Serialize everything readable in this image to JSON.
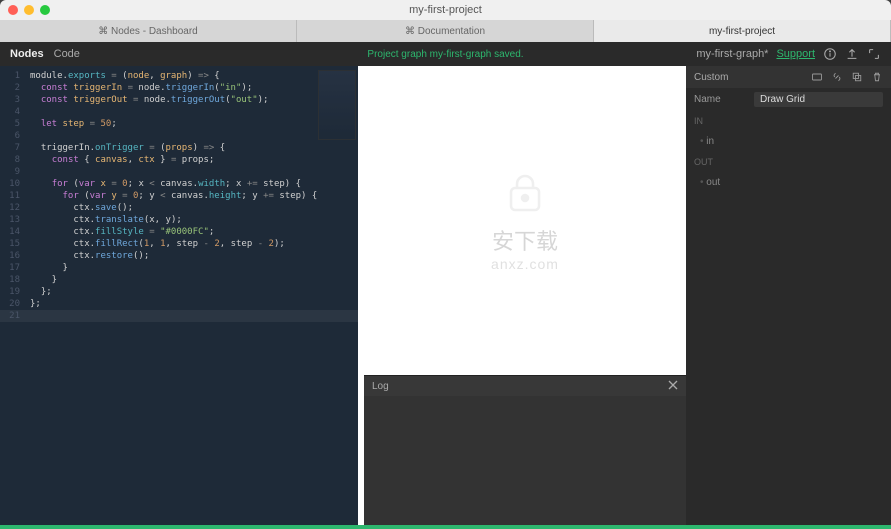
{
  "window": {
    "title": "my-first-project"
  },
  "tabs": [
    {
      "label": "⌘ Nodes - Dashboard",
      "active": false
    },
    {
      "label": "⌘ Documentation",
      "active": false
    },
    {
      "label": "my-first-project",
      "active": true
    }
  ],
  "header": {
    "brand": "Nodes",
    "mode": "Code",
    "status_message": "Project graph my-first-graph saved.",
    "graph_name": "my-first-graph*",
    "support": "Support"
  },
  "code": {
    "lines": [
      "module.exports = (node, graph) => {",
      "  const triggerIn = node.triggerIn(\"in\");",
      "  const triggerOut = node.triggerOut(\"out\");",
      "",
      "  let step = 50;",
      "",
      "  triggerIn.onTrigger = (props) => {",
      "    const { canvas, ctx } = props;",
      "",
      "    for (var x = 0; x < canvas.width; x += step) {",
      "      for (var y = 0; y < canvas.height; y += step) {",
      "        ctx.save();",
      "        ctx.translate(x, y);",
      "        ctx.fillStyle = \"#0000FC\";",
      "        ctx.fillRect(1, 1, step - 2, step - 2);",
      "        ctx.restore();",
      "      }",
      "    }",
      "  };",
      "};",
      ""
    ],
    "line_numbers": [
      "1",
      "2",
      "3",
      "4",
      "5",
      "6",
      "7",
      "8",
      "9",
      "10",
      "11",
      "12",
      "13",
      "14",
      "15",
      "16",
      "17",
      "18",
      "19",
      "20",
      "21"
    ],
    "cursor_line": 21,
    "fill_color": "#0000FC",
    "step_value": 50
  },
  "log": {
    "title": "Log"
  },
  "inspector": {
    "type_label": "Custom",
    "name_label": "Name",
    "name_value": "Draw Grid",
    "sections": {
      "in_label": "IN",
      "in_ports": [
        "in"
      ],
      "out_label": "OUT",
      "out_ports": [
        "out"
      ]
    }
  },
  "watermark": {
    "text": "安下载",
    "sub": "anxz.com"
  }
}
